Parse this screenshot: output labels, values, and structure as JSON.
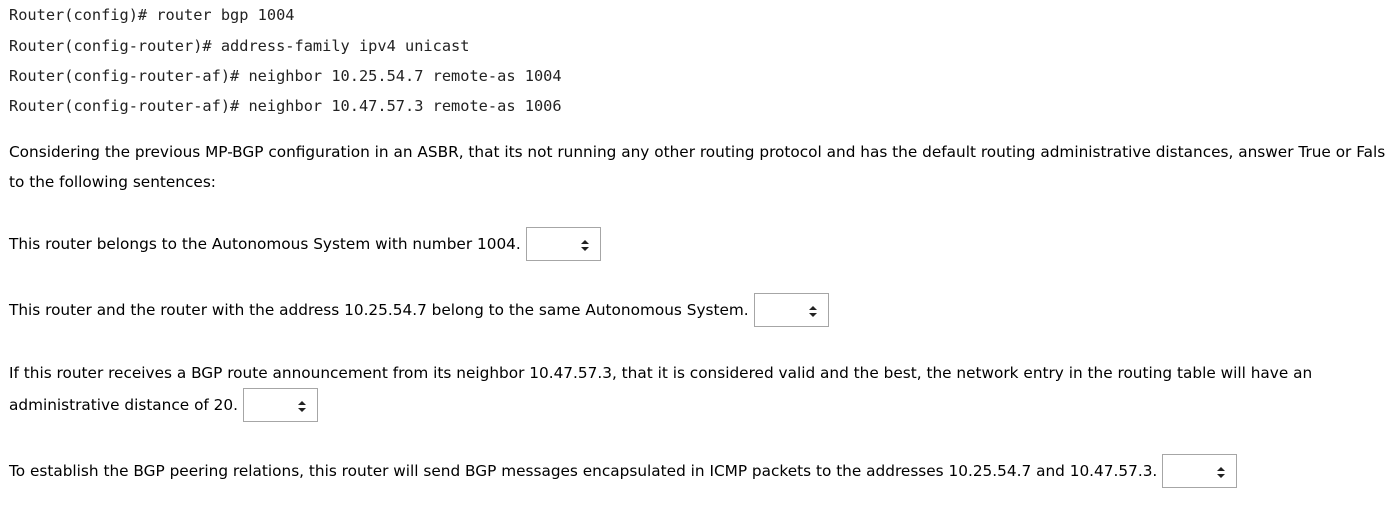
{
  "config": {
    "lines": [
      "Router(config)# router bgp 1004",
      "Router(config-router)# address-family ipv4 unicast",
      "Router(config-router-af)# neighbor 10.25.54.7 remote-as 1004",
      "Router(config-router-af)# neighbor 10.47.57.3 remote-as 1006"
    ]
  },
  "instructions": {
    "line1": "Considering the previous MP-BGP configuration in an ASBR, that its not running any other routing protocol and has the default routing administrative distances, answer True or False",
    "line2": "to the following sentences:"
  },
  "questions": [
    {
      "text": "This router belongs to the Autonomous System with number 1004.",
      "selected": "",
      "icon": "up-down-arrows-icon"
    },
    {
      "text": "This router and the router with the address 10.25.54.7 belong to the same Autonomous System.",
      "selected": "",
      "icon": "up-down-arrows-icon"
    },
    {
      "text_line1": "If this router receives a BGP route announcement from its neighbor 10.47.57.3, that it is considered valid and the best, the network entry in the routing table will have an",
      "text_line2": "administrative distance of 20.",
      "selected": "",
      "icon": "up-down-arrows-icon"
    },
    {
      "text": "To establish the BGP peering relations, this router will send BGP messages encapsulated in ICMP packets to the addresses 10.25.54.7 and 10.47.57.3.",
      "selected": "",
      "icon": "up-down-arrows-icon"
    }
  ]
}
